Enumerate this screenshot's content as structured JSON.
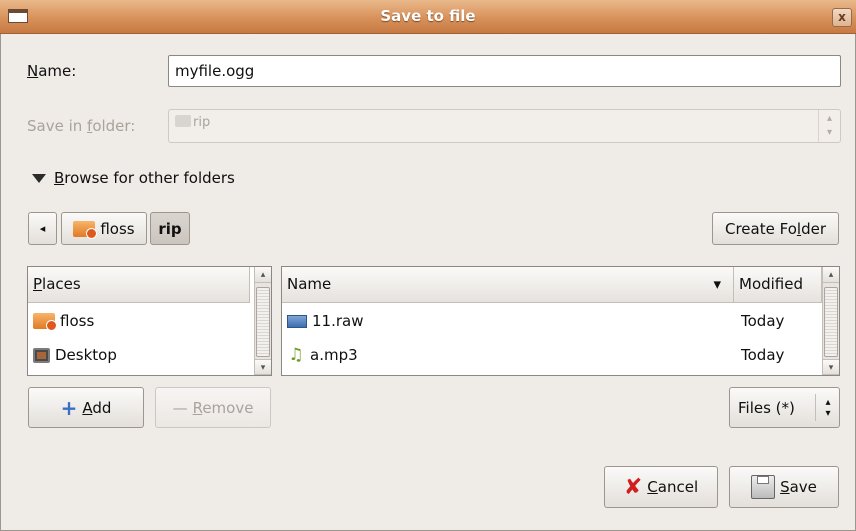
{
  "window": {
    "title": "Save to file",
    "close_glyph": "x"
  },
  "name_field": {
    "label_prefix": "",
    "label_mnemonic": "N",
    "label_rest": "ame:",
    "value": "myfile.ogg"
  },
  "save_in": {
    "label_prefix": "Save in ",
    "label_mnemonic": "f",
    "label_rest": "older:",
    "value": "rip"
  },
  "expander": {
    "label_mnemonic": "B",
    "label_rest": "rowse for other folders",
    "expanded": true
  },
  "path_bar": {
    "back_glyph": "◂",
    "crumbs": [
      "floss",
      "rip"
    ],
    "active": "rip"
  },
  "create_folder": {
    "label_pre": "Create Fo",
    "label_mnemonic": "l",
    "label_post": "der"
  },
  "places": {
    "header_mnemonic": "P",
    "header_rest": "laces",
    "items": [
      {
        "label": "floss",
        "icon": "folder-home-icon"
      },
      {
        "label": "Desktop",
        "icon": "desktop-icon"
      }
    ]
  },
  "files": {
    "columns": [
      "Name",
      "Modified"
    ],
    "sort_glyph": "▾",
    "rows": [
      {
        "name": "11.raw",
        "modified": "Today",
        "icon": "image-file-icon"
      },
      {
        "name": "a.mp3",
        "modified": "Today",
        "icon": "audio-file-icon"
      }
    ]
  },
  "add_button": {
    "glyph": "+",
    "mnemonic": "A",
    "rest": "dd"
  },
  "remove_button": {
    "glyph": "—",
    "mnemonic": "R",
    "rest": "emove"
  },
  "filter": {
    "value": "Files (*)",
    "arrows": "▴▾"
  },
  "cancel_button": {
    "mnemonic": "C",
    "rest": "ancel",
    "icon": "cancel-icon"
  },
  "save_button": {
    "mnemonic": "S",
    "rest": "ave",
    "icon": "floppy-disk-icon"
  },
  "colors": {
    "titlebar": "#d8915a",
    "window_bg": "#efebe7",
    "folder": "#e17a23"
  }
}
